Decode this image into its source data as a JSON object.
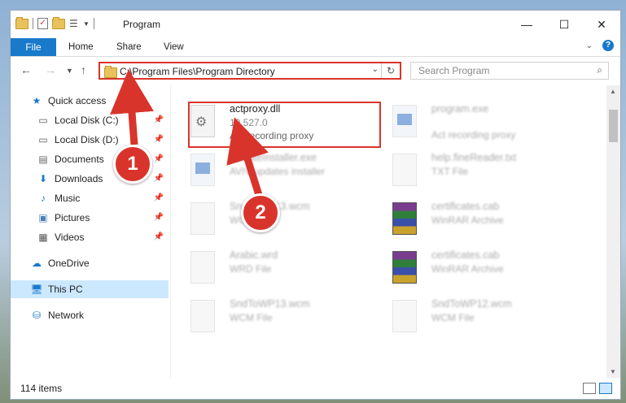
{
  "window": {
    "title": "Program"
  },
  "ribbon": {
    "tabs": [
      "File",
      "Home",
      "Share",
      "View"
    ]
  },
  "address": {
    "path": "C:\\Program Files\\Program Directory"
  },
  "search": {
    "placeholder": "Search Program"
  },
  "nav": {
    "items": [
      {
        "label": "Quick access",
        "icon": "star-icon"
      },
      {
        "label": "Local Disk (C:)",
        "icon": "drive-icon"
      },
      {
        "label": "Local Disk (D:)",
        "icon": "drive-icon"
      },
      {
        "label": "Documents",
        "icon": "documents-icon"
      },
      {
        "label": "Downloads",
        "icon": "download-icon"
      },
      {
        "label": "Music",
        "icon": "music-icon"
      },
      {
        "label": "Pictures",
        "icon": "pictures-icon"
      },
      {
        "label": "Videos",
        "icon": "videos-icon"
      },
      {
        "label": "OneDrive",
        "icon": "cloud-icon"
      },
      {
        "label": "This PC",
        "icon": "computer-icon"
      },
      {
        "label": "Network",
        "icon": "network-icon"
      }
    ]
  },
  "files": [
    {
      "name": "actproxy.dll",
      "meta1": "10.527.0",
      "meta2": "Act recording proxy",
      "icon": "dll-file-icon"
    },
    {
      "name": "program.exe",
      "meta1": "Act recording proxy",
      "meta2": "",
      "icon": "exe-file-icon"
    },
    {
      "name": "UpdateInstaller.exe",
      "meta1": "AVIV updates installer",
      "meta2": "",
      "icon": "installer-icon"
    },
    {
      "name": "help.fineReader.txt",
      "meta1": "TXT File",
      "meta2": "",
      "icon": "txt-file-icon"
    },
    {
      "name": "SndToWP13.wcm",
      "meta1": "WCM File",
      "meta2": "",
      "icon": "wcm-file-icon"
    },
    {
      "name": "certificates.cab",
      "meta1": "WinRAR Archive",
      "meta2": "",
      "icon": "rar-archive-icon"
    },
    {
      "name": "Arabic.wrd",
      "meta1": "WRD File",
      "meta2": "",
      "icon": "wrd-file-icon"
    },
    {
      "name": "certificates.cab",
      "meta1": "WinRAR Archive",
      "meta2": "",
      "icon": "rar-archive-icon"
    },
    {
      "name": "SndToWP13.wcm",
      "meta1": "WCM File",
      "meta2": "",
      "icon": "wcm-file-icon"
    },
    {
      "name": "SndToWP12.wcm",
      "meta1": "WCM File",
      "meta2": "",
      "icon": "wcm-file-icon"
    }
  ],
  "status": {
    "count": "114 items"
  },
  "callouts": [
    "1",
    "2"
  ],
  "colors": {
    "accent": "#1979ca",
    "highlight": "#d9342b",
    "selected": "#cce8ff"
  }
}
